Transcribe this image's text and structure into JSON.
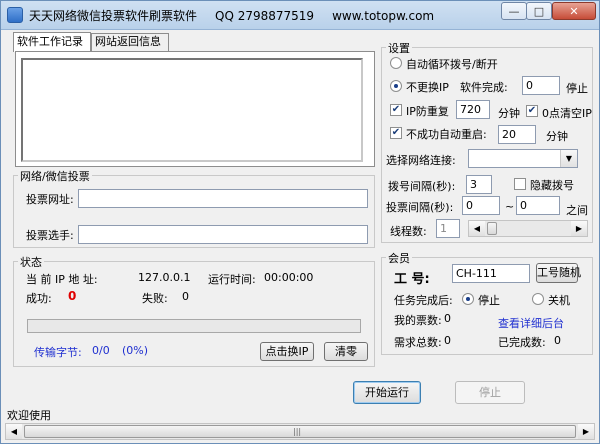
{
  "window": {
    "title": "天天网络微信投票软件刷票软件",
    "qq": "QQ 2798877519",
    "url": "www.totopw.com",
    "min_glyph": "—",
    "max_glyph": "□",
    "close_glyph": "✕"
  },
  "tabs": [
    "软件工作记录",
    "网站返回信息"
  ],
  "vote": {
    "title": "网络/微信投票",
    "url_label": "投票网址:",
    "url_value": "",
    "option_label": "投票选手:",
    "option_value": ""
  },
  "status": {
    "title": "状态",
    "ip_label": "当 前 IP 地 址:",
    "ip_value": "127.0.0.1",
    "runtime_label": "运行时间:",
    "runtime_value": "00:00:00",
    "success_label": "成功:",
    "success_value": "0",
    "fail_label": "失败:",
    "fail_value": "0",
    "progress": 0,
    "bytes_label": "传输字节:",
    "bytes_value": "0/0",
    "bytes_pct": "(0%)",
    "change_ip_button": "点击换IP",
    "clear_button": "清零"
  },
  "settings": {
    "title": "设置",
    "auto_dial_label": "自动循环拨号/断开",
    "no_change_ip_label": "不更换IP",
    "complete_label": "软件完成:",
    "complete_value": "0",
    "stop_label": "停止",
    "ip_dedupe_label": "IP防重复",
    "ip_dedupe_value": "720",
    "minutes_label": "分钟",
    "clear_ip_label": "0点清空IP",
    "auto_restart_label": "不成功自动重启:",
    "auto_restart_value": "20",
    "minutes_label2": "分钟",
    "network_label": "选择网络连接:",
    "network_value": "",
    "dial_interval_label": "拨号间隔(秒):",
    "dial_interval_value": "3",
    "hide_dial_label": "隐藏拨号",
    "vote_interval_label": "投票间隔(秒):",
    "vote_interval_from": "0",
    "vote_interval_tilde": "~",
    "vote_interval_to": "0",
    "between_label": "之间",
    "threads_label": "线程数:",
    "threads_value": "1"
  },
  "member": {
    "title": "会员",
    "id_label": "工  号:",
    "id_value": "CH-111",
    "random_button": "工号随机",
    "task_done_label": "任务完成后:",
    "stop_option": "停止",
    "shutdown_option": "关机",
    "my_votes_label": "我的票数:",
    "my_votes_value": "0",
    "view_backend_link": "查看详细后台",
    "total_needed_label": "需求总数:",
    "total_needed_value": "0",
    "done_label": "已完成数:",
    "done_value": "0"
  },
  "actions": {
    "start_button": "开始运行",
    "stop_button": "停止"
  },
  "statusbar": {
    "text": "欢迎使用"
  },
  "colors": {
    "red_value": "#e00000",
    "blue_text": "#1f2fd0"
  }
}
